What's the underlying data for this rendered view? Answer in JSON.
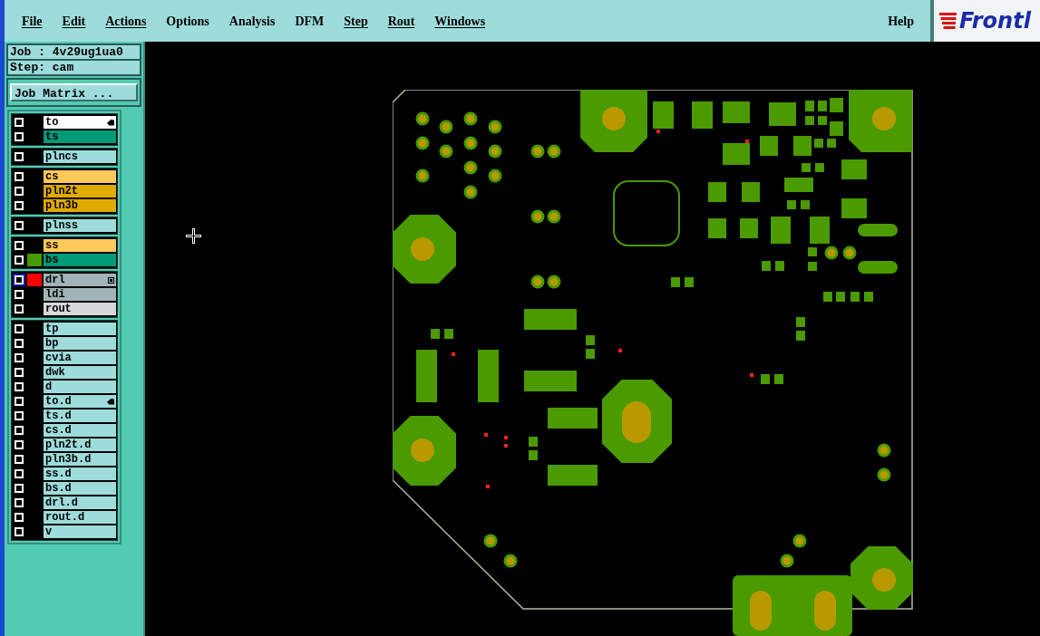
{
  "menu": [
    {
      "label": "File",
      "underline": true
    },
    {
      "label": "Edit",
      "underline": true
    },
    {
      "label": "Actions",
      "underline": true
    },
    {
      "label": "Options",
      "underline": false
    },
    {
      "label": "Analysis",
      "underline": false
    },
    {
      "label": "DFM",
      "underline": false
    },
    {
      "label": "Step",
      "underline": true
    },
    {
      "label": "Rout",
      "underline": true
    },
    {
      "label": "Windows",
      "underline": true
    }
  ],
  "help": "Help",
  "logo": "Frontl",
  "job": "Job : 4v29ug1ua0",
  "step": "Step: cam",
  "job_matrix_button": "Job Matrix ...",
  "layer_groups": [
    [
      {
        "name": "to",
        "color": "#ffffff",
        "checked": false,
        "marker": true
      },
      {
        "name": "ts",
        "color": "#009a78",
        "checked": false
      }
    ],
    [
      {
        "name": "plncs",
        "color": "#9edcdc",
        "checked": false
      }
    ],
    [
      {
        "name": "cs",
        "color": "#ffc85a",
        "checked": false
      },
      {
        "name": "pln2t",
        "color": "#e0aa00",
        "checked": false
      },
      {
        "name": "pln3b",
        "color": "#e0aa00",
        "checked": false
      }
    ],
    [
      {
        "name": "plnss",
        "color": "#9edcdc",
        "checked": false
      }
    ],
    [
      {
        "name": "ss",
        "color": "#ffc85a",
        "checked": false
      },
      {
        "name": "bs",
        "color": "#009a78",
        "checked": false,
        "swatch": {
          "color": "#449a00"
        }
      }
    ],
    [
      {
        "name": "drl",
        "color": "#a0b4b8",
        "checked": false,
        "swatch": {
          "color": "#ff0000"
        },
        "focused": true,
        "expand": true
      },
      {
        "name": "ldi",
        "color": "#a0b4b8",
        "checked": false
      },
      {
        "name": "rout",
        "color": "#d8d8d8",
        "checked": false
      }
    ],
    [
      {
        "name": "tp",
        "color": "#9edcdc",
        "checked": false
      },
      {
        "name": "bp",
        "color": "#9edcdc",
        "checked": false
      },
      {
        "name": "cvia",
        "color": "#9edcdc",
        "checked": false
      },
      {
        "name": "dwk",
        "color": "#9edcdc",
        "checked": false
      },
      {
        "name": "d",
        "color": "#9edcdc",
        "checked": false
      },
      {
        "name": "to.d",
        "color": "#9edcdc",
        "checked": false,
        "marker": true
      },
      {
        "name": "ts.d",
        "color": "#9edcdc",
        "checked": false
      },
      {
        "name": "cs.d",
        "color": "#9edcdc",
        "checked": false
      },
      {
        "name": "pln2t.d",
        "color": "#9edcdc",
        "checked": false
      },
      {
        "name": "pln3b.d",
        "color": "#9edcdc",
        "checked": false
      },
      {
        "name": "ss.d",
        "color": "#9edcdc",
        "checked": false
      },
      {
        "name": "bs.d",
        "color": "#9edcdc",
        "checked": false
      },
      {
        "name": "drl.d",
        "color": "#9edcdc",
        "checked": false
      },
      {
        "name": "rout.d",
        "color": "#9edcdc",
        "checked": false
      },
      {
        "name": "v",
        "color": "#9edcdc",
        "checked": false
      }
    ]
  ]
}
